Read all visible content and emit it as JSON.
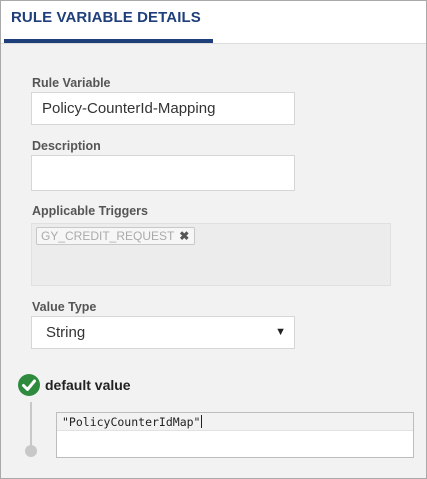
{
  "header": {
    "title": "RULE VARIABLE DETAILS"
  },
  "form": {
    "rule_variable": {
      "label": "Rule Variable",
      "value": "Policy-CounterId-Mapping"
    },
    "description": {
      "label": "Description",
      "value": ""
    },
    "applicable_triggers": {
      "label": "Applicable Triggers",
      "chips": [
        {
          "label": "GY_CREDIT_REQUEST",
          "remove_icon": "close-icon"
        }
      ]
    },
    "value_type": {
      "label": "Value Type",
      "selected": "String",
      "arrow_icon": "caret-down-icon"
    },
    "default_value": {
      "label": "default value",
      "status_icon": "check-circle-icon",
      "status_color": "#2e8b3e",
      "code": "\"PolicyCounterIdMap\""
    }
  },
  "colors": {
    "accent": "#1f3f7a",
    "background": "#f2f2f2"
  }
}
